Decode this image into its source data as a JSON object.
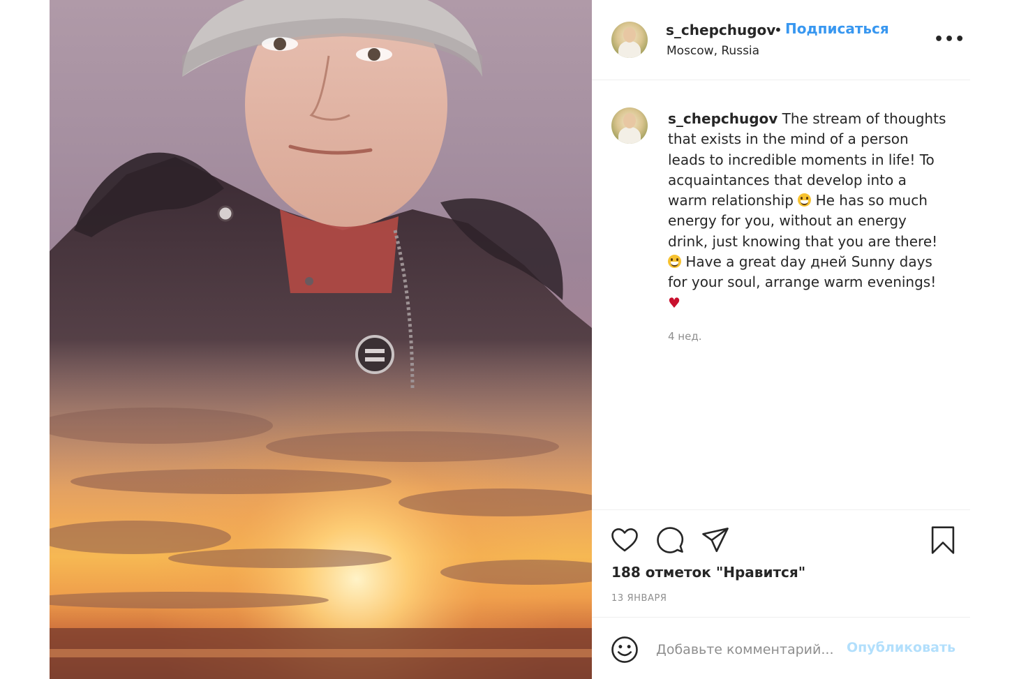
{
  "post": {
    "username": "s_chepchugov",
    "separator": "•",
    "follow_label": "Подписаться",
    "location": "Moscow, Russia",
    "more_label": "•••",
    "caption": {
      "part1": "The stream of thoughts that exists in the mind of a person leads to incredible moments in life! To acquaintances that develop into a warm relationship",
      "part2": "He has so much energy for you, without an energy drink, just knowing that you are there!",
      "part3": "Have a great day дней Sunny days for your soul, arrange warm evenings!",
      "heart": "♥"
    },
    "time_ago": "4 нед.",
    "likes": "188 отметок \"Нравится\"",
    "date": "13 ЯНВАРЯ",
    "comment_placeholder": "Добавьте комментарий...",
    "publish_label": "Опубликовать"
  },
  "icons": {
    "like": "heart-icon",
    "comment": "comment-icon",
    "share": "share-icon",
    "save": "bookmark-icon",
    "emoji": "smiley-icon",
    "caption_emoji": "grinning-face-emoji"
  },
  "colors": {
    "accent": "#3897f0",
    "publish_disabled": "#b2dffc",
    "muted": "#8e8e8e",
    "text": "#262626",
    "heart": "#c8102e"
  }
}
